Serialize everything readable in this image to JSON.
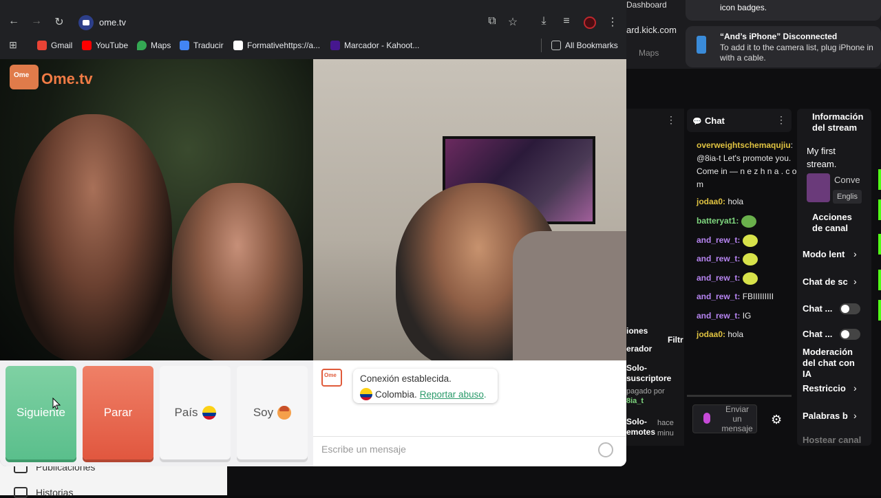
{
  "browser": {
    "url": "ome.tv",
    "bookmarks": [
      {
        "label": "Gmail",
        "color": "#ea4335"
      },
      {
        "label": "YouTube",
        "color": "#ff0000"
      },
      {
        "label": "Maps",
        "color": "#34a853"
      },
      {
        "label": "Traducir",
        "color": "#4285f4"
      },
      {
        "label": "Formativehttps://a...",
        "color": "#ffffff"
      },
      {
        "label": "Marcador - Kahoot...",
        "color": "#46178f"
      }
    ],
    "all_bookmarks": "All Bookmarks",
    "icons": [
      "back-icon",
      "forward-icon",
      "reload-icon",
      "cast-icon",
      "star-icon",
      "download-icon",
      "media-icon",
      "profile-icon",
      "menu-icon",
      "apps-icon"
    ]
  },
  "ometv": {
    "logo_small": "Ome",
    "logo_text": "Ome.tv",
    "buttons": {
      "next": "Siguiente",
      "stop": "Parar",
      "country": "País",
      "me": "Soy"
    },
    "chat": {
      "line1": "Conexión establecida.",
      "country": "Colombia.",
      "report": "Reportar abuso",
      "report_suffix": ".",
      "input_placeholder": "Escribe un mensaje"
    },
    "colors": {
      "next": "#5abf8c",
      "stop": "#e1573f",
      "brand": "#f07b45"
    }
  },
  "background": {
    "dashboard_label": "Dashboard",
    "url_fragment": "ard.kick.com",
    "maps_label": "Maps",
    "notifications": [
      {
        "title": "",
        "body": "icon badges."
      },
      {
        "title": "“And’s iPhone” Disconnected",
        "body": "To add it to the camera list, plug iPhone in with a cable."
      }
    ],
    "chat": {
      "title": "Chat",
      "messages": [
        {
          "user": "overweightschemaqujiu",
          "text": ": @8ia-t Let's promote you. Come in — n e z h n a . c o m",
          "color": "y"
        },
        {
          "user": "jodaa0:",
          "text": " hola",
          "color": "y"
        },
        {
          "user": "batteryat1:",
          "text": "",
          "color": "g"
        },
        {
          "user": "and_rew_t:",
          "text": "",
          "color": "p"
        },
        {
          "user": "and_rew_t:",
          "text": "",
          "color": "p"
        },
        {
          "user": "and_rew_t:",
          "text": "",
          "color": "p"
        },
        {
          "user": "and_rew_t:",
          "text": " FBIIIIIIIII",
          "color": "p"
        },
        {
          "user": "and_rew_t:",
          "text": " IG",
          "color": "p"
        },
        {
          "user": "jodaa0:",
          "text": " hola",
          "color": "y"
        }
      ],
      "send": "Enviar un mensaje"
    },
    "stream_info": {
      "title": "Información del stream",
      "stream_name": "My first stream.",
      "lang1": "Conve",
      "lang2": "Englis"
    },
    "actions": {
      "title": "Acciones de canal",
      "items": [
        "Modo lent",
        "Chat de sc",
        "Chat ...",
        "Chat ...",
        "Moderación del chat con IA",
        "Restriccio",
        "Palabras b",
        "Hostear canal"
      ]
    },
    "left_panel": {
      "items": [
        "iones",
        "erador",
        "Filtr",
        "Solo-suscriptore",
        "pagado por",
        "8ia_t",
        "Solo-emotes",
        "hace minu"
      ]
    },
    "sidebar_bottom": [
      "Publicaciones",
      "Historias"
    ]
  }
}
